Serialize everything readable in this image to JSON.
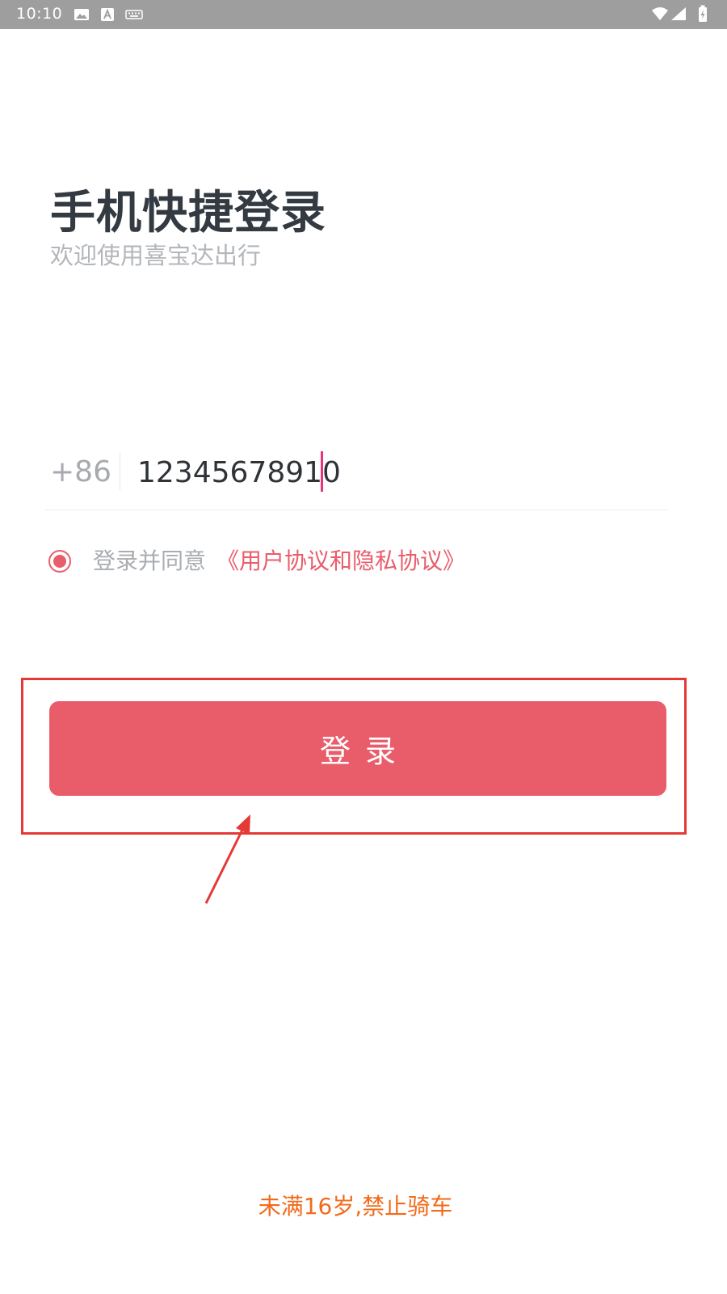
{
  "status_bar": {
    "time": "10:10",
    "icons": [
      "image-icon",
      "a-icon",
      "keyboard-icon",
      "wifi-icon",
      "signal-icon",
      "battery-icon"
    ]
  },
  "header": {
    "title": "手机快捷登录",
    "subtitle": "欢迎使用喜宝达出行"
  },
  "phone": {
    "country_code": "+86",
    "value": "12345678910"
  },
  "agreement": {
    "checked": true,
    "prefix": "登录并同意",
    "link": "《用户协议和隐私协议》"
  },
  "login_button": {
    "label": "登录"
  },
  "footer": {
    "warning": "未满16岁,禁止骑车"
  },
  "colors": {
    "accent": "#e95d6b",
    "warning": "#f26a1b",
    "annotation": "#e53935",
    "caret": "#e8327a"
  }
}
